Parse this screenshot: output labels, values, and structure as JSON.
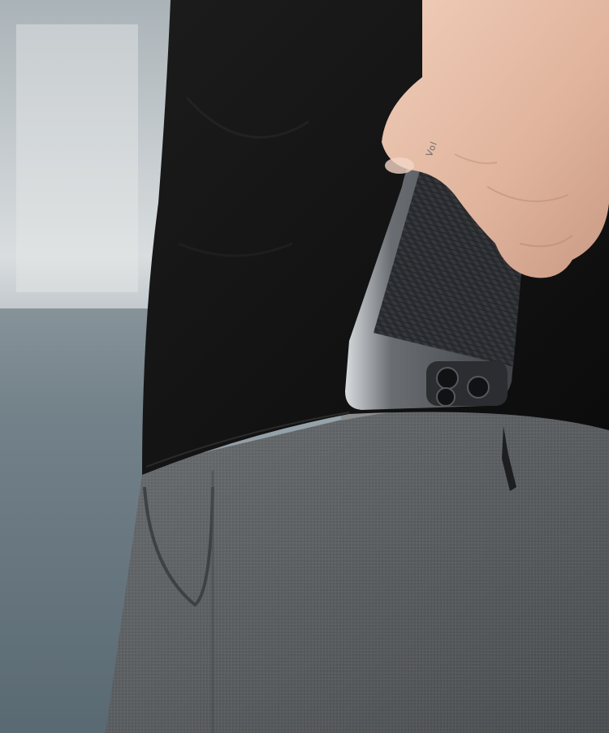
{
  "scene": {
    "description_kind": "product-photo",
    "colors": {
      "background_sky": "#c9cfd2",
      "background_building": "#6f7f88",
      "shirt": "#141414",
      "pants": "#5e6063",
      "skin": "#e4b9a2",
      "phone_frame": "#3f4246",
      "case_carbon": "#2c2e31"
    }
  },
  "phone_case": {
    "logo_text": "Vol",
    "icons": [
      "camera-lens-icon",
      "camera-lens-icon",
      "camera-lens-icon"
    ]
  }
}
